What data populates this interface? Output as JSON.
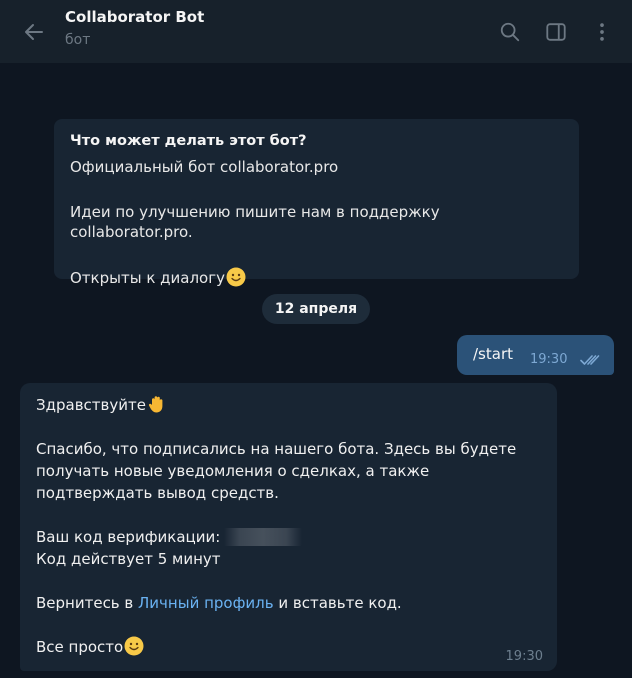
{
  "header": {
    "title": "Collaborator Bot",
    "subtitle": "бот",
    "back_icon": "arrow-left-icon",
    "actions": [
      "search-icon",
      "sidebar-toggle-icon",
      "more-vertical-icon"
    ]
  },
  "bot_info": {
    "title": "Что может делать этот бот?",
    "line1": "Официальный бот collaborator.pro",
    "line2": "Идеи по улучшению пишите нам в поддержку collaborator.pro.",
    "line3": "Открыты к диалогу",
    "line3_emoji": "smiling-face-icon"
  },
  "date_separator": "12 апреля",
  "outgoing": {
    "text": "/start",
    "time": "19:30",
    "status_icon": "double-check-icon"
  },
  "incoming": {
    "greeting": "Здравствуйте",
    "greeting_emoji": "raised-hand-icon",
    "para1": "Спасибо, что подписались на нашего бота. Здесь вы будете получать новые уведомления о сделках, а также подтверждать вывод средств.",
    "code_label": "Ваш код верификации:",
    "code_valid": "Код действует 5 минут",
    "return_prefix": "Вернитесь в ",
    "return_link": "Личный профиль",
    "return_suffix": " и вставьте код.",
    "closing": "Все просто",
    "closing_emoji": "smiling-face-icon",
    "time": "19:30"
  },
  "colors": {
    "background": "#0e1621",
    "header": "#17212b",
    "incoming_bubble": "#182533",
    "outgoing_bubble": "#2b5278",
    "link": "#6ab2f2"
  }
}
